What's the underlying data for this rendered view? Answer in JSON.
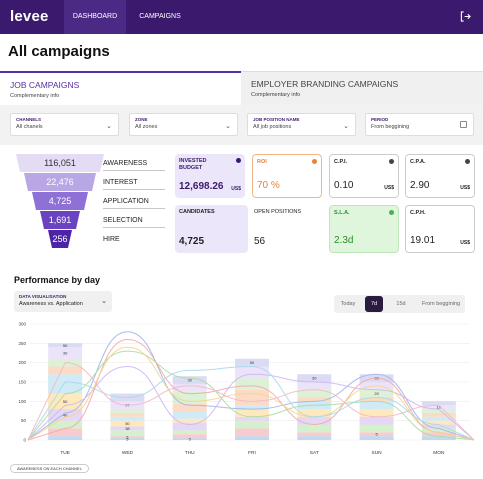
{
  "topbar": {
    "logo": "levee",
    "nav": {
      "dashboard": "DASHBOARD",
      "campaigns": "CAMPAIGNS"
    }
  },
  "page": {
    "title": "All campaigns"
  },
  "tabs": {
    "job": {
      "label": "JOB CAMPAIGNS",
      "sub": "Complementary info"
    },
    "employer": {
      "label": "EMPLOYER BRANDING CAMPAIGNS",
      "sub": "Complementary info"
    }
  },
  "filters": {
    "channels": {
      "label": "CHANNELS",
      "value": "All chanels"
    },
    "zone": {
      "label": "ZONE",
      "value": "All zones"
    },
    "position": {
      "label": "JOB POSITION NAME",
      "value": "All job positions"
    },
    "period": {
      "label": "PERIOD",
      "value": "From beggining"
    }
  },
  "funnel": [
    {
      "value": "116,051",
      "label": "AWARENESS"
    },
    {
      "value": "22,476",
      "label": "INTEREST"
    },
    {
      "value": "4,725",
      "label": "APPLICATION"
    },
    {
      "value": "1,691",
      "label": "SELECTION"
    },
    {
      "value": "256",
      "label": "HIRE"
    }
  ],
  "kpis": {
    "invested": {
      "title": "INVESTED BUDGET",
      "value": "12,698.26",
      "unit": "US$"
    },
    "roi": {
      "title": "ROI",
      "value": "70 %"
    },
    "cpi": {
      "title": "C.P.I.",
      "value": "0.10",
      "unit": "US$"
    },
    "cpa": {
      "title": "C.P.A.",
      "value": "2.90",
      "unit": "US$"
    },
    "candidates": {
      "title": "CANDIDATES",
      "value": "4,725"
    },
    "positions": {
      "title": "OPEN POSITIONS",
      "value": "56"
    },
    "sla": {
      "title": "S.L.A.",
      "value": "2.3d"
    },
    "cph": {
      "title": "C.P.H.",
      "value": "19.01",
      "unit": "US$"
    }
  },
  "performance": {
    "title": "Performance by day",
    "dataviz": {
      "label": "DATA VISUALISATION",
      "value": "Awareness vs. Application"
    },
    "periods": [
      "Today",
      "7d",
      "15d",
      "From beggining"
    ],
    "active_period": "7d",
    "legend": "AWARENESS ON EACH CHANNEL"
  },
  "colors": {
    "primary": "#3b1a6e",
    "accent": "#5a2ea6",
    "roi": "#e8833a",
    "sla": "#2e8b2e"
  },
  "chart_data": {
    "type": "bar",
    "categories": [
      "TUE",
      "WED",
      "THU",
      "FRI",
      "SAT",
      "SUN",
      "MON"
    ],
    "ylim": [
      0,
      300
    ],
    "yticks": [
      0,
      50,
      100,
      150,
      200,
      250,
      300
    ],
    "stack_colors": [
      "#bcd4f0",
      "#f7c6c6",
      "#cfeec8",
      "#e3d3f5",
      "#fde7b5",
      "#cbe8f5",
      "#fbd7c0",
      "#d8f0d0",
      "#e8e0f8",
      "#d7d7f2"
    ],
    "series_segments": [
      {
        "x": "TUE",
        "segments": [
          10,
          20,
          20,
          30,
          40,
          50,
          20,
          20,
          30,
          10
        ],
        "labels": [
          "",
          "",
          "",
          "40",
          "50",
          "",
          "",
          "",
          "30",
          "50"
        ]
      },
      {
        "x": "WED",
        "segments": [
          5,
          5,
          15,
          10,
          15,
          10,
          10,
          10,
          20,
          20
        ],
        "labels": [
          "5",
          "5",
          "",
          "38",
          "50",
          "",
          "",
          "",
          "97",
          ""
        ]
      },
      {
        "x": "THU",
        "segments": [
          5,
          10,
          10,
          20,
          10,
          20,
          20,
          30,
          20,
          20
        ],
        "labels": [
          "5",
          "",
          "",
          "",
          "",
          "",
          "",
          "",
          "",
          "30"
        ]
      },
      {
        "x": "FRI",
        "segments": [
          10,
          20,
          20,
          10,
          20,
          10,
          40,
          30,
          30,
          20
        ],
        "labels": [
          "",
          "",
          "",
          "",
          "",
          "",
          "",
          "",
          "",
          "50"
        ]
      },
      {
        "x": "SAT",
        "segments": [
          10,
          10,
          20,
          20,
          20,
          20,
          10,
          20,
          20,
          20
        ],
        "labels": [
          "",
          "",
          "",
          "",
          "",
          "",
          "",
          "",
          "",
          "30"
        ]
      },
      {
        "x": "SUN",
        "segments": [
          10,
          10,
          20,
          20,
          20,
          20,
          10,
          20,
          20,
          20
        ],
        "labels": [
          "",
          "5",
          "",
          "",
          "",
          "",
          "",
          "20",
          "",
          "30"
        ]
      },
      {
        "x": "MON",
        "segments": [
          10,
          10,
          10,
          10,
          10,
          10,
          10,
          10,
          10,
          10
        ],
        "labels": [
          "",
          "",
          "",
          "",
          "",
          "",
          "",
          "",
          "10",
          ""
        ]
      }
    ],
    "line_series": [
      {
        "color": "#9fb6e8",
        "values": [
          70,
          280,
          90,
          80,
          100,
          170,
          30
        ]
      },
      {
        "color": "#f3a9a9",
        "values": [
          30,
          260,
          120,
          140,
          40,
          160,
          20
        ]
      },
      {
        "color": "#a9dca4",
        "values": [
          120,
          230,
          160,
          60,
          90,
          100,
          10
        ]
      },
      {
        "color": "#cdb6f0",
        "values": [
          90,
          190,
          40,
          170,
          150,
          130,
          80
        ]
      },
      {
        "color": "#f6d48a",
        "values": [
          60,
          240,
          100,
          120,
          60,
          140,
          20
        ]
      },
      {
        "color": "#a8d8ec",
        "values": [
          150,
          110,
          180,
          190,
          60,
          110,
          40
        ]
      },
      {
        "color": "#f2b9c8",
        "values": [
          200,
          90,
          140,
          100,
          130,
          60,
          90
        ]
      }
    ]
  }
}
